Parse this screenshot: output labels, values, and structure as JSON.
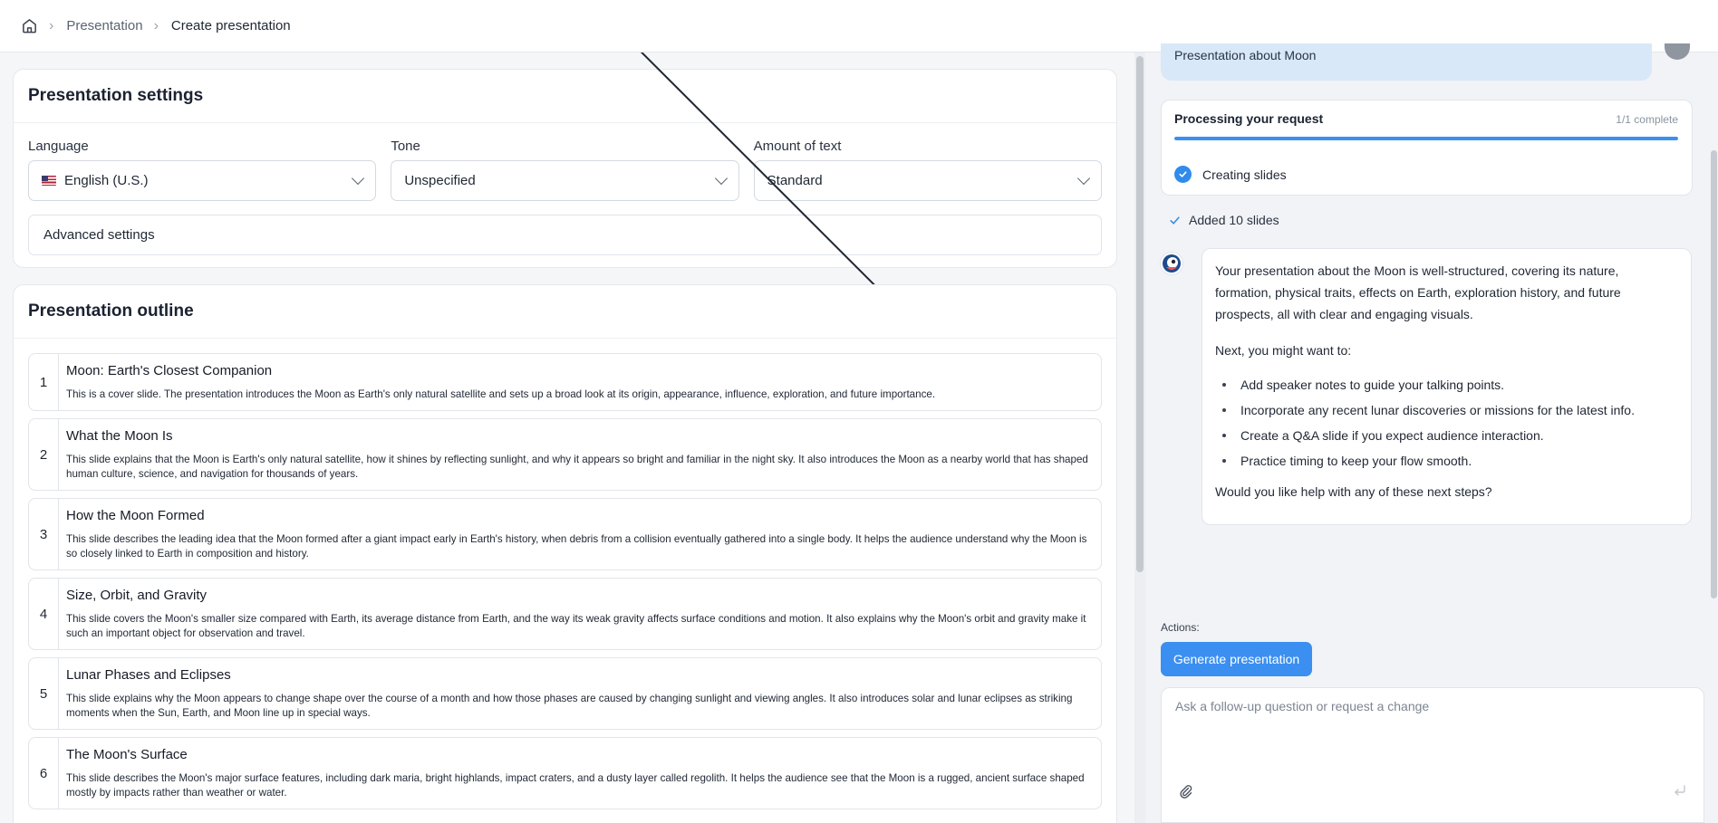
{
  "breadcrumb": {
    "home_icon": "home-icon",
    "items": [
      "Presentation",
      "Create presentation"
    ]
  },
  "settings": {
    "title": "Presentation settings",
    "language": {
      "label": "Language",
      "value": "English (U.S.)",
      "flag_icon": "us-flag-icon"
    },
    "tone": {
      "label": "Tone",
      "value": "Unspecified"
    },
    "amount": {
      "label": "Amount of text",
      "value": "Standard"
    },
    "advanced_label": "Advanced settings"
  },
  "outline": {
    "title": "Presentation outline",
    "items": [
      {
        "num": "1",
        "title": "Moon: Earth's Closest Companion",
        "desc": "This is a cover slide. The presentation introduces the Moon as Earth's only natural satellite and sets up a broad look at its origin, appearance, influence, exploration, and future importance."
      },
      {
        "num": "2",
        "title": "What the Moon Is",
        "desc": "This slide explains that the Moon is Earth's only natural satellite, how it shines by reflecting sunlight, and why it appears so bright and familiar in the night sky. It also introduces the Moon as a nearby world that has shaped human culture, science, and navigation for thousands of years."
      },
      {
        "num": "3",
        "title": "How the Moon Formed",
        "desc": "This slide describes the leading idea that the Moon formed after a giant impact early in Earth's history, when debris from a collision eventually gathered into a single body. It helps the audience understand why the Moon is so closely linked to Earth in composition and history."
      },
      {
        "num": "4",
        "title": "Size, Orbit, and Gravity",
        "desc": "This slide covers the Moon's smaller size compared with Earth, its average distance from Earth, and the way its weak gravity affects surface conditions and motion. It also explains why the Moon's orbit and gravity make it such an important object for observation and travel."
      },
      {
        "num": "5",
        "title": "Lunar Phases and Eclipses",
        "desc": "This slide explains why the Moon appears to change shape over the course of a month and how those phases are caused by changing sunlight and viewing angles. It also introduces solar and lunar eclipses as striking moments when the Sun, Earth, and Moon line up in special ways."
      },
      {
        "num": "6",
        "title": "The Moon's Surface",
        "desc": "This slide describes the Moon's major surface features, including dark maria, bright highlands, impact craters, and a dusty layer called regolith. It helps the audience see that the Moon is a rugged, ancient surface shaped mostly by impacts rather than weather or water."
      }
    ]
  },
  "chat": {
    "user_message": "Presentation about Moon",
    "process": {
      "title": "Processing your request",
      "count": "1/1 complete",
      "progress_fraction": 1.0,
      "step": "Creating slides"
    },
    "added": "Added 10 slides",
    "reply": {
      "p1": "Your presentation about the Moon is well-structured, covering its nature, formation, physical traits, effects on Earth, exploration history, and future prospects, all with clear and engaging visuals.",
      "p2": "Next, you might want to:",
      "bullets": [
        "Add speaker notes to guide your talking points.",
        "Incorporate any recent lunar discoveries or missions for the latest info.",
        "Create a Q&A slide if you expect audience interaction.",
        "Practice timing to keep your flow smooth."
      ],
      "p3": "Would you like help with any of these next steps?"
    },
    "actions_label": "Actions:",
    "generate_label": "Generate presentation",
    "followup_placeholder": "Ask a follow-up question or request a change"
  },
  "colors": {
    "accent": "#3b8ff0",
    "user_bubble": "#d8e8f8"
  }
}
